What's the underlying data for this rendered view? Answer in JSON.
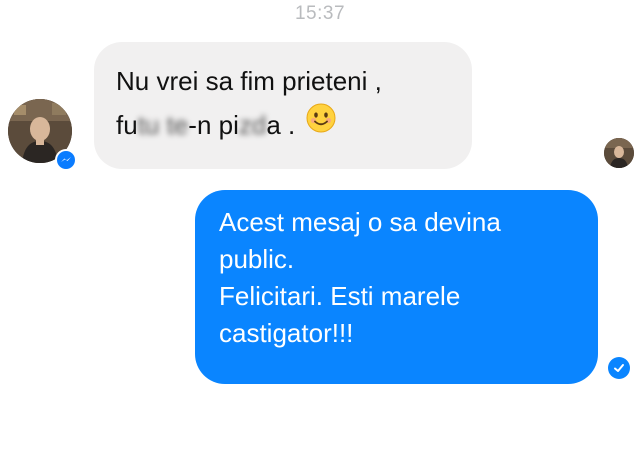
{
  "conversation": {
    "timestamp": "15:37",
    "incoming": {
      "line1": "Nu vrei sa fim prieteni ,",
      "line2_part1": "fu",
      "line2_blur1": "tu te",
      "line2_part2": "-n pi",
      "line2_blur2": "zd",
      "line2_part3": "a .",
      "emoji": "smiling-face-emoji",
      "sender_avatar": "profile-photo",
      "badge_icon": "messenger-icon"
    },
    "outgoing": {
      "lines": [
        "Acest mesaj o sa devina",
        "public.",
        "Felicitari. Esti marele",
        "castigator!!!"
      ],
      "status_icon": "seen-check-icon"
    }
  },
  "colors": {
    "outgoing_bubble": "#0a85ff",
    "incoming_bubble": "#f1f0f0",
    "timestamp_text": "#b9bbbe",
    "messenger_blue": "#0a7cff"
  }
}
